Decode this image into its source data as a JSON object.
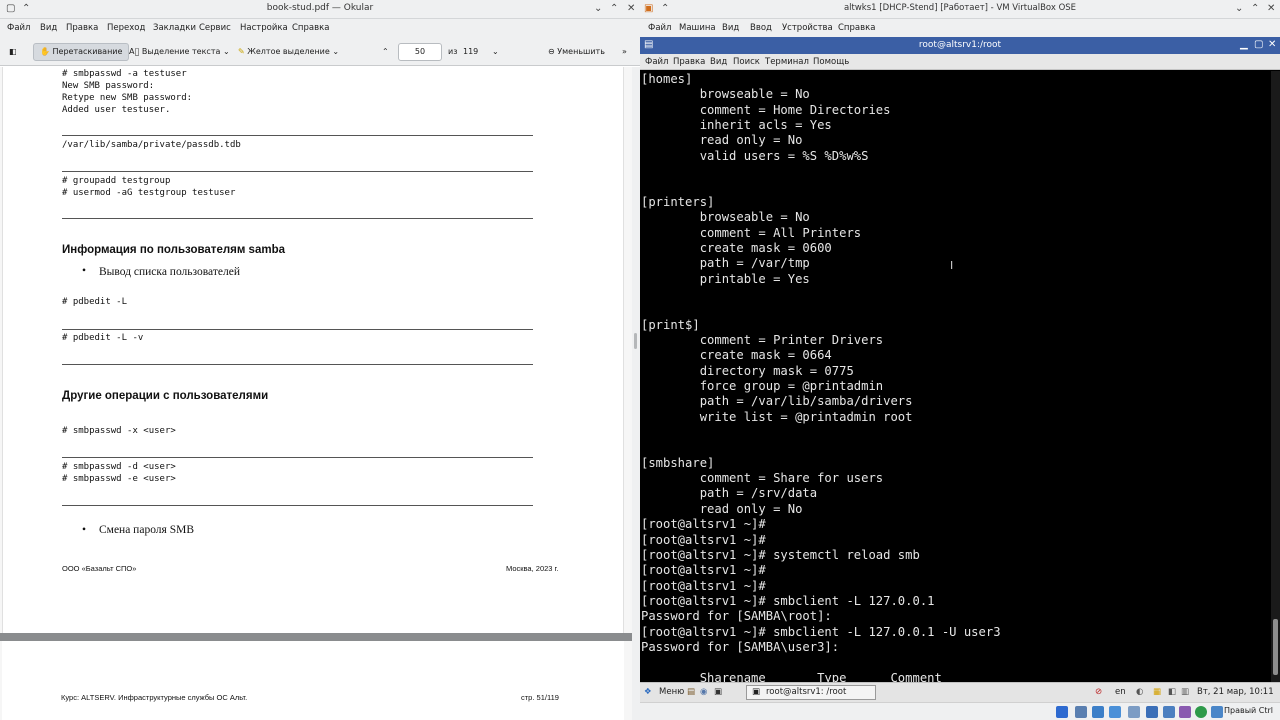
{
  "okular": {
    "window_title": "book-stud.pdf — Okular",
    "menu": [
      "Файл",
      "Вид",
      "Правка",
      "Переход",
      "Закладки",
      "Сервис",
      "Настройка",
      "Справка"
    ],
    "toolbar": {
      "browse_label": "Перетаскивание",
      "text_select_label": "Выделение текста",
      "highlight_label": "Желтое выделение",
      "page_value": "50",
      "of_label": "из",
      "page_total": "119",
      "zoom_out_label": "Уменьшить"
    },
    "page": {
      "code1": "# smbpasswd -a testuser\nNew SMB password:\nRetype new SMB password:\nAdded user testuser.",
      "code2": "/var/lib/samba/private/passdb.tdb",
      "code3": "# groupadd testgroup\n# usermod -aG testgroup testuser",
      "heading1": "Информация по пользователям samba",
      "bullet1": "Вывод списка пользователей",
      "code4": "# pdbedit -L",
      "code5": "# pdbedit -L -v",
      "heading2": "Другие операции с пользователями",
      "code6": "# smbpasswd -x <user>",
      "code7": "# smbpasswd -d <user>\n# smbpasswd -e <user>",
      "bullet2": "Смена пароля SMB",
      "footer_left": "ООО «Базальт СПО»",
      "footer_right": "Москва, 2023 г.",
      "page2_left": "Курс: ALTSERV. Инфраструктурные службы ОС Альт.",
      "page2_right": "стр. 51/119"
    }
  },
  "vbox": {
    "window_title": "altwks1 [DHCP-Stend] [Работает] - VM VirtualBox OSE",
    "menu": [
      "Файл",
      "Машина",
      "Вид",
      "Ввод",
      "Устройства",
      "Справка"
    ],
    "terminal": {
      "title": "root@altsrv1:/root",
      "menu": [
        "Файл",
        "Правка",
        "Вид",
        "Поиск",
        "Терминал",
        "Помощь"
      ],
      "lines": [
        "[homes]",
        "        browseable = No",
        "        comment = Home Directories",
        "        inherit acls = Yes",
        "        read only = No",
        "        valid users = %S %D%w%S",
        "",
        "",
        "[printers]",
        "        browseable = No",
        "        comment = All Printers",
        "        create mask = 0600",
        "        path = /var/tmp",
        "        printable = Yes",
        "",
        "",
        "[print$]",
        "        comment = Printer Drivers",
        "        create mask = 0664",
        "        directory mask = 0775",
        "        force group = @printadmin",
        "        path = /var/lib/samba/drivers",
        "        write list = @printadmin root",
        "",
        "",
        "[smbshare]",
        "        comment = Share for users",
        "        path = /srv/data",
        "        read only = No",
        "[root@altsrv1 ~]#",
        "[root@altsrv1 ~]#",
        "[root@altsrv1 ~]# systemctl reload smb",
        "[root@altsrv1 ~]#",
        "[root@altsrv1 ~]#",
        "[root@altsrv1 ~]# smbclient -L 127.0.0.1",
        "Password for [SAMBA\\root]:",
        "[root@altsrv1 ~]# smbclient -L 127.0.0.1 -U user3",
        "Password for [SAMBA\\user3]:",
        "",
        "        Sharename       Type      Comment"
      ]
    },
    "guest_panel": {
      "menu_label": "Меню",
      "task_label": "root@altsrv1: /root",
      "lang": "en",
      "clock": "Вт, 21 мар, 10:11"
    },
    "host_key": "Правый Ctrl"
  }
}
